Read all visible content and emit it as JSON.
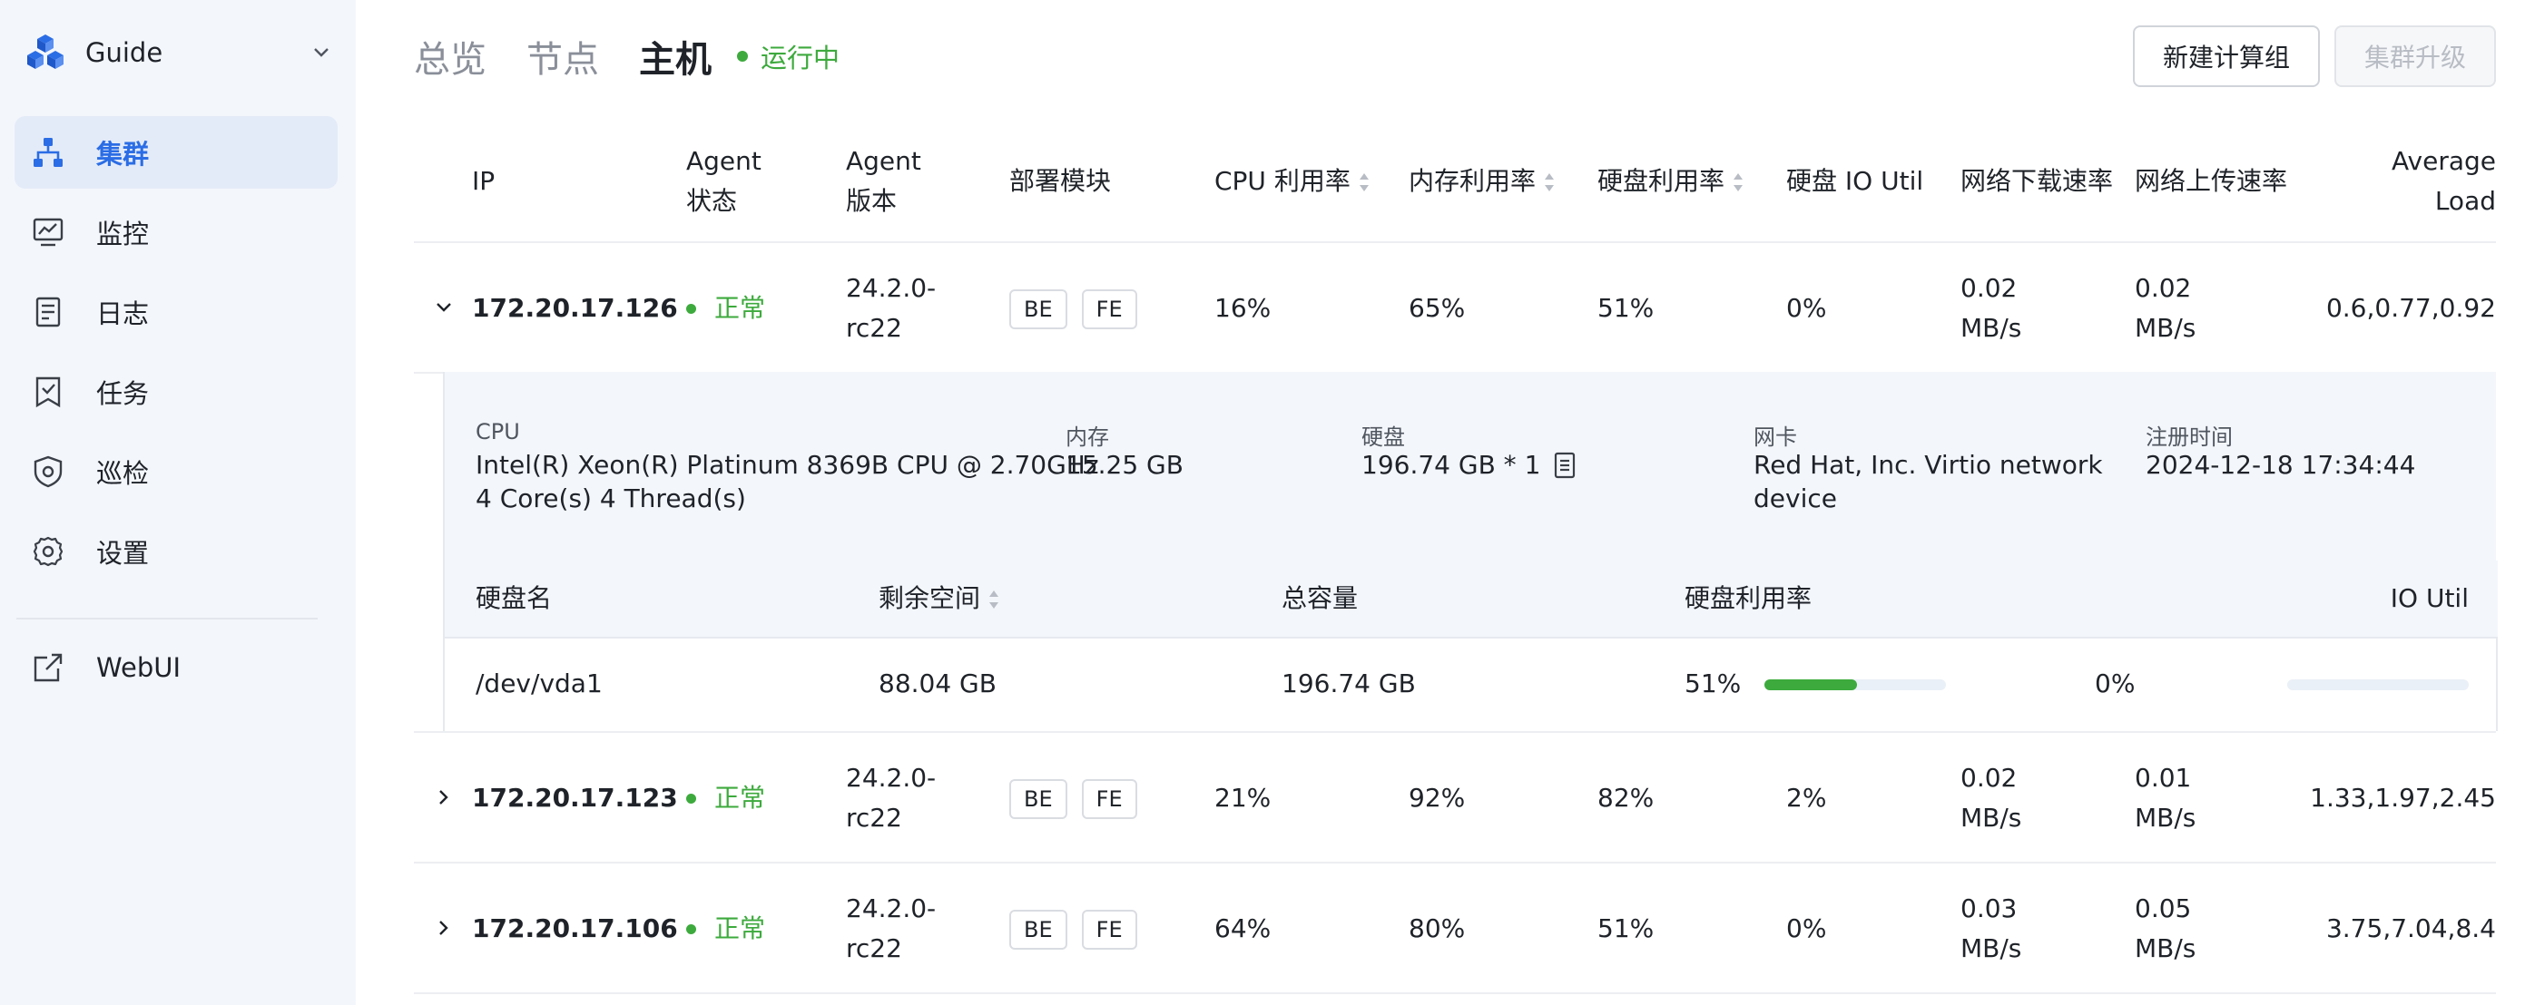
{
  "sidebar": {
    "brand": "Guide",
    "items": [
      {
        "label": "集群",
        "icon": "cluster-icon",
        "active": true
      },
      {
        "label": "监控",
        "icon": "monitor-icon"
      },
      {
        "label": "日志",
        "icon": "log-icon"
      },
      {
        "label": "任务",
        "icon": "task-icon"
      },
      {
        "label": "巡检",
        "icon": "inspection-shield-icon"
      },
      {
        "label": "设置",
        "icon": "gear-icon"
      }
    ],
    "webui": {
      "label": "WebUI",
      "icon": "external-link-icon"
    }
  },
  "header": {
    "tabs": [
      "总览",
      "节点",
      "主机"
    ],
    "active_tab": "主机",
    "status": "运行中",
    "new_group_button": "新建计算组",
    "upgrade_button": "集群升级"
  },
  "table": {
    "columns": {
      "ip": "IP",
      "agent_status_1": "Agent",
      "agent_status_2": "状态",
      "agent_version_1": "Agent",
      "agent_version_2": "版本",
      "modules": "部署模块",
      "cpu": "CPU 利用率",
      "mem": "内存利用率",
      "disk": "硬盘利用率",
      "disk_io": "硬盘 IO Util",
      "net_down": "网络下载速率",
      "net_up": "网络上传速率",
      "load_1": "Average",
      "load_2": "Load"
    },
    "rows": [
      {
        "ip": "172.20.17.126",
        "status": "正常",
        "ver1": "24.2.0-",
        "ver2": "rc22",
        "m1": "BE",
        "m2": "FE",
        "cpu": "16%",
        "mem": "65%",
        "disk": "51%",
        "io": "0%",
        "down1": "0.02",
        "down2": "MB/s",
        "up1": "0.02",
        "up2": "MB/s",
        "load": "0.6,0.77,0.92",
        "expanded": true
      },
      {
        "ip": "172.20.17.123",
        "status": "正常",
        "ver1": "24.2.0-",
        "ver2": "rc22",
        "m1": "BE",
        "m2": "FE",
        "cpu": "21%",
        "mem": "92%",
        "disk": "82%",
        "io": "2%",
        "down1": "0.02",
        "down2": "MB/s",
        "up1": "0.01",
        "up2": "MB/s",
        "load": "1.33,1.97,2.45"
      },
      {
        "ip": "172.20.17.106",
        "status": "正常",
        "ver1": "24.2.0-",
        "ver2": "rc22",
        "m1": "BE",
        "m2": "FE",
        "cpu": "64%",
        "mem": "80%",
        "disk": "51%",
        "io": "0%",
        "down1": "0.03",
        "down2": "MB/s",
        "up1": "0.05",
        "up2": "MB/s",
        "load": "3.75,7.04,8.4"
      }
    ]
  },
  "detail": {
    "cpu_label": "CPU",
    "cpu_line1": "Intel(R) Xeon(R) Platinum 8369B CPU @ 2.70GHz",
    "cpu_line2": "4 Core(s) 4 Thread(s)",
    "mem_label": "内存",
    "mem_value": "15.25 GB",
    "disk_label": "硬盘",
    "disk_value": "196.74 GB * 1",
    "nic_label": "网卡",
    "nic_line1": "Red Hat, Inc. Virtio network",
    "nic_line2": "device",
    "reg_label": "注册时间",
    "reg_value": "2024-12-18 17:34:44",
    "disk_table": {
      "headers": {
        "name": "硬盘名",
        "free": "剩余空间",
        "total": "总容量",
        "usage": "硬盘利用率",
        "io": "IO Util"
      },
      "row": {
        "name": "/dev/vda1",
        "free": "88.04 GB",
        "total": "196.74 GB",
        "usage": "51%",
        "usage_value": 51,
        "io": "0%",
        "io_value": 0
      }
    }
  },
  "colors": {
    "accent": "#2b6de5",
    "success": "#3daa3d",
    "sidebar_bg": "#f3f6fb"
  }
}
